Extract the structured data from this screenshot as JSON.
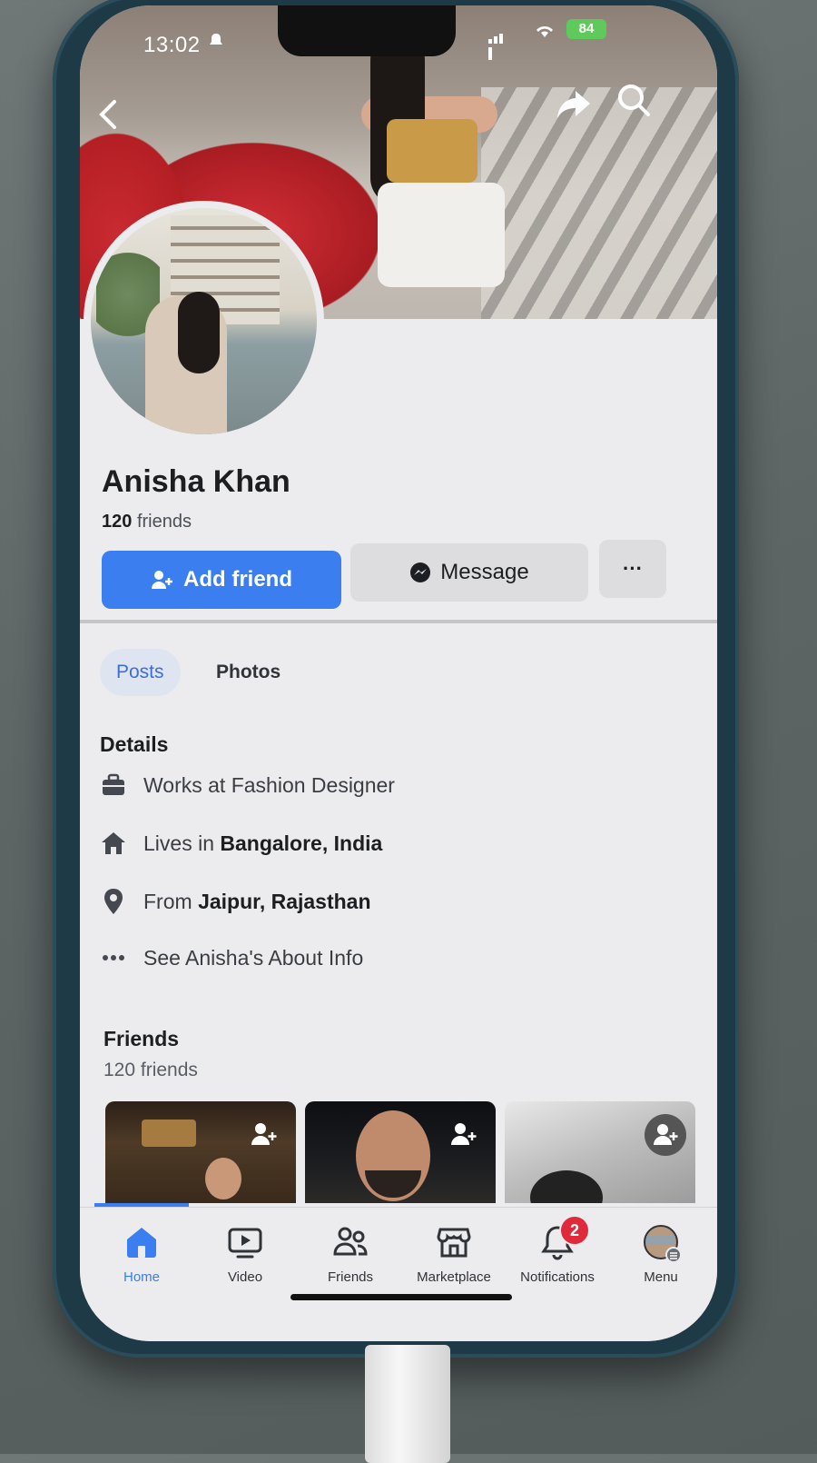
{
  "status_bar": {
    "time": "13:02",
    "battery": "84"
  },
  "profile": {
    "name": "Anisha Khan",
    "friends_count_number": "120",
    "friends_count_label": "friends"
  },
  "actions": {
    "add_friend": "Add friend",
    "message": "Message",
    "more": "···"
  },
  "tabs": [
    {
      "label": "Posts",
      "selected": true
    },
    {
      "label": "Photos",
      "selected": false
    }
  ],
  "details": {
    "title": "Details",
    "work": {
      "prefix": "Works at Fashion Designer",
      "value": ""
    },
    "lives": {
      "prefix": "Lives in",
      "value": "Bangalore, India"
    },
    "from": {
      "prefix": "From",
      "value": "Jaipur, Rajasthan"
    },
    "about": "See Anisha's About Info"
  },
  "friends_section": {
    "title": "Friends",
    "subtitle": "120 friends"
  },
  "bottom_nav": [
    {
      "label": "Home",
      "icon": "home-icon",
      "active": true
    },
    {
      "label": "Video",
      "icon": "video-icon"
    },
    {
      "label": "Friends",
      "icon": "friends-icon"
    },
    {
      "label": "Marketplace",
      "icon": "marketplace-icon"
    },
    {
      "label": "Notifications",
      "icon": "bell-icon",
      "badge": "2"
    },
    {
      "label": "Menu",
      "icon": "avatar-menu-icon"
    }
  ],
  "colors": {
    "accent": "#3a7ef0",
    "badge": "#e0293b"
  }
}
